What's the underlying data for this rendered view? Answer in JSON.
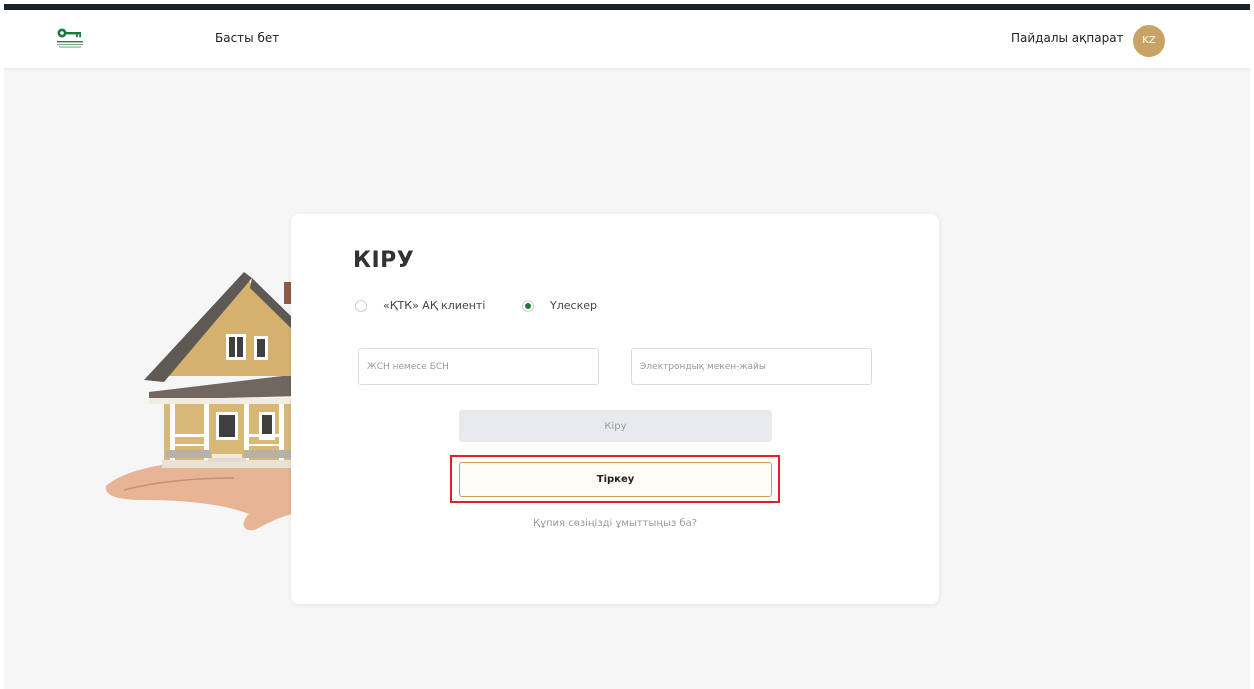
{
  "header": {
    "nav_home": "Басты бет",
    "nav_info": "Пайдалы ақпарат",
    "language": "KZ"
  },
  "login": {
    "title": "КІРУ",
    "radio_options": [
      {
        "label": "«ҚТК» АҚ клиенті",
        "checked": false
      },
      {
        "label": "Үлескер",
        "checked": true
      }
    ],
    "iin_placeholder": "ЖСН немесе БСН",
    "email_placeholder": "Электрондық мекен-жайы",
    "login_button": "Кіру",
    "register_button": "Тіркеу",
    "forgot_password": "Құпия сөзіңізді ұмыттыңыз ба?"
  },
  "colors": {
    "top_bar": "#19222e",
    "avatar": "#c9a265",
    "radio_checked": "#1e7a3c",
    "highlight": "#e31e24",
    "register_border": "#c8a060"
  },
  "icons": [
    "key-logo-icon",
    "house-in-hand-illustration"
  ]
}
